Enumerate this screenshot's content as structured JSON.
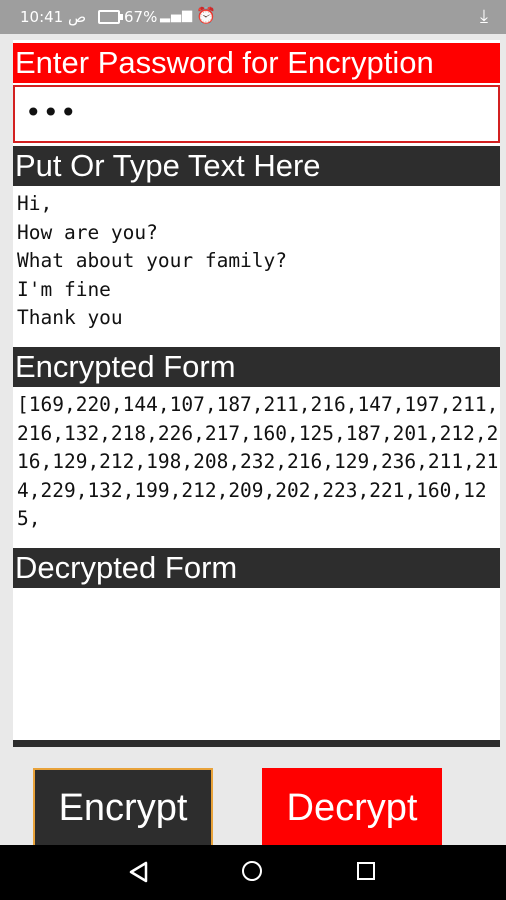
{
  "status_bar": {
    "time": "10:41 ص",
    "battery": "67%",
    "icons": [
      "battery-icon",
      "signal-icon",
      "alarm-icon",
      "download-icon"
    ]
  },
  "password": {
    "label": "Enter Password for Encryption",
    "value": "•••"
  },
  "input_text": {
    "label": "Put Or Type Text Here",
    "value": "Hi,\nHow are you?\nWhat about your family?\nI'm fine\nThank you"
  },
  "encrypted": {
    "label": "Encrypted Form",
    "value": "[169,220,144,107,187,211,216,147,197,211,216,132,218,226,217,160,125,187,201,212,216,129,212,198,208,232,216,129,236,211,214,229,132,199,212,209,202,223,221,160,125,"
  },
  "decrypted": {
    "label": "Decrypted Form",
    "value": ""
  },
  "buttons": {
    "encrypt": "Encrypt",
    "decrypt": "Decrypt"
  },
  "colors": {
    "red": "#ff0000",
    "dark": "#2d2d2d",
    "status_bar": "#9e9e9e",
    "encrypt_border": "#e8a23a"
  }
}
